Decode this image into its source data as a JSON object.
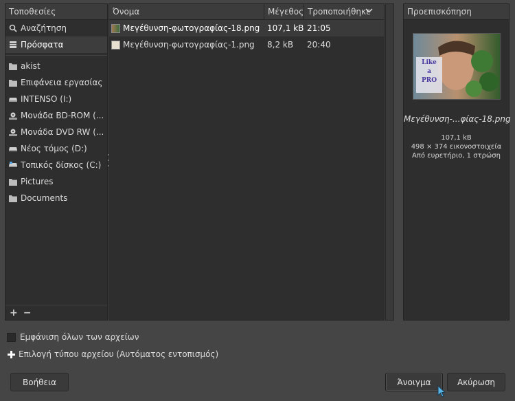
{
  "places": {
    "header": "Τοποθεσίες",
    "items": [
      {
        "label": "Αναζήτηση",
        "icon": "search-icon",
        "selected": false
      },
      {
        "label": "Πρόσφατα",
        "icon": "recent-icon",
        "selected": true
      }
    ],
    "drives": [
      {
        "label": "akist",
        "icon": "folder-icon"
      },
      {
        "label": "Επιφάνεια εργασίας",
        "icon": "folder-icon"
      },
      {
        "label": "INTENSO (I:)",
        "icon": "drive-icon"
      },
      {
        "label": "Μονάδα BD-ROM (...",
        "icon": "optical-drive-icon"
      },
      {
        "label": "Μονάδα DVD RW (...",
        "icon": "optical-drive-icon"
      },
      {
        "label": "Νέος τόμος (D:)",
        "icon": "drive-icon"
      },
      {
        "label": "Τοπικός δίσκος (C:)",
        "icon": "system-drive-icon"
      }
    ],
    "bookmarks": [
      {
        "label": "Pictures",
        "icon": "folder-icon"
      },
      {
        "label": "Documents",
        "icon": "folder-icon"
      }
    ],
    "add_label": "+",
    "remove_label": "−"
  },
  "files": {
    "columns": {
      "name": "Όνομα",
      "size": "Μέγεθος",
      "modified": "Τροποποιήθηκε"
    },
    "rows": [
      {
        "name": "Μεγέθυνση-φωτογραφίας-18.png",
        "size": "107,1 kB",
        "modified": "21:05",
        "selected": true
      },
      {
        "name": "Μεγέθυνση-φωτογραφίας-1.png",
        "size": "8,2 kB",
        "modified": "20:40",
        "selected": false
      }
    ]
  },
  "preview": {
    "header": "Προεπισκόπηση",
    "image_text": [
      "Like",
      "a",
      "PRO"
    ],
    "filename": "Μεγέθυνση-...φίας-18.png",
    "size": "107,1 kB",
    "dimensions": "498 × 374 εικονοστοιχεία",
    "mode": "Από ευρετήριο, 1 στρώση"
  },
  "options": {
    "show_all_files": "Εμφάνιση όλων των αρχείων",
    "file_type": "Επιλογή τύπου αρχείου (Αυτόματος εντοπισμός)"
  },
  "buttons": {
    "help": "Βοήθεια",
    "open": "Άνοιγμα",
    "cancel": "Ακύρωση"
  },
  "colors": {
    "background": "#454545",
    "panel": "#2e2e2e",
    "selection": "#3d3d3d",
    "image_text": "#4a3aa0"
  }
}
